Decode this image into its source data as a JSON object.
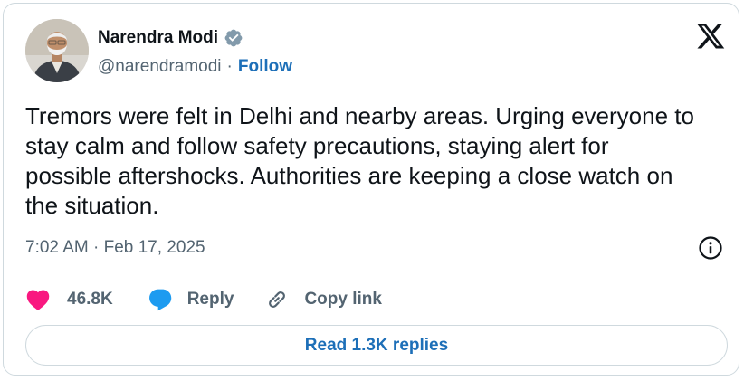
{
  "author": {
    "name": "Narendra Modi",
    "handle": "@narendramodi",
    "separator": "·",
    "follow_label": "Follow",
    "verified": true
  },
  "tweet": {
    "text": "Tremors were felt in Delhi and nearby areas. Urging everyone to stay calm and follow safety precautions, staying alert for possible aftershocks. Authorities are keeping a close watch on the situation.",
    "timestamp": "7:02 AM · Feb 17, 2025"
  },
  "actions": {
    "like_count": "46.8K",
    "reply_label": "Reply",
    "copy_link_label": "Copy link"
  },
  "footer": {
    "read_replies_label": "Read 1.3K replies"
  },
  "icons": {
    "avatar": "avatar-photo",
    "verified": "verified-badge-icon",
    "logo": "x-logo-icon",
    "info": "info-icon",
    "like": "heart-icon",
    "reply": "speech-bubble-icon",
    "copy_link": "link-icon"
  },
  "colors": {
    "accent": "#1d6fb8",
    "heart": "#f91880",
    "reply_bubble": "#1d9bf0",
    "verified": "#829aab",
    "secondary_text": "#536471",
    "border": "#cfd9de"
  }
}
